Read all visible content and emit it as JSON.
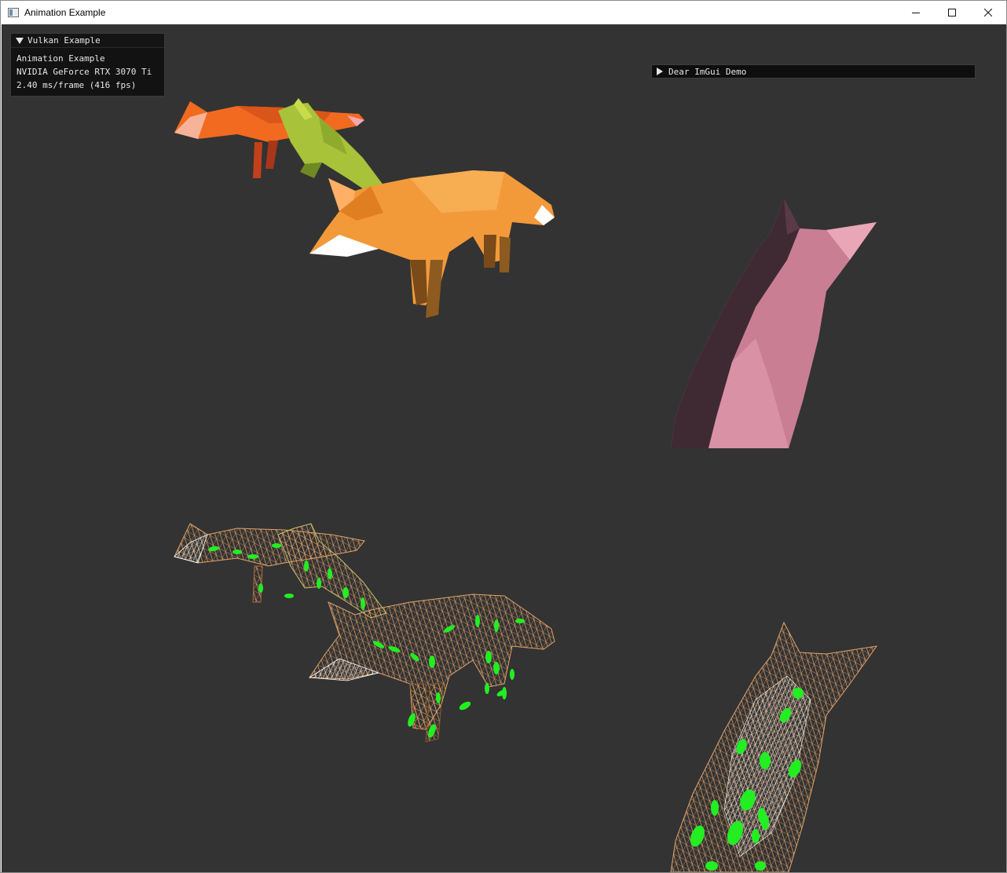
{
  "window": {
    "title": "Animation Example",
    "controls": {
      "minimize": "minimize-icon",
      "maximize": "maximize-icon",
      "close": "close-icon"
    }
  },
  "overlay": {
    "panel": {
      "header": "Vulkan Example",
      "lines": [
        "Animation Example",
        "NVIDIA GeForce RTX 3070 Ti",
        "2.40 ms/frame (416 fps)"
      ]
    },
    "demo": {
      "header": "Dear ImGui Demo"
    }
  },
  "scene": {
    "background": "#333333",
    "models": [
      {
        "name": "fox-red",
        "mode": "solid",
        "color": "#f26a20"
      },
      {
        "name": "fox-green",
        "mode": "solid",
        "color": "#a8c23a"
      },
      {
        "name": "fox-orange",
        "mode": "solid",
        "color": "#f29a3a"
      },
      {
        "name": "fox-pink",
        "mode": "solid",
        "color": "#c97e94"
      },
      {
        "name": "fox-wireframes",
        "mode": "wireframe",
        "color": "#e3a36a",
        "joint_color": "#22ee22"
      }
    ]
  }
}
